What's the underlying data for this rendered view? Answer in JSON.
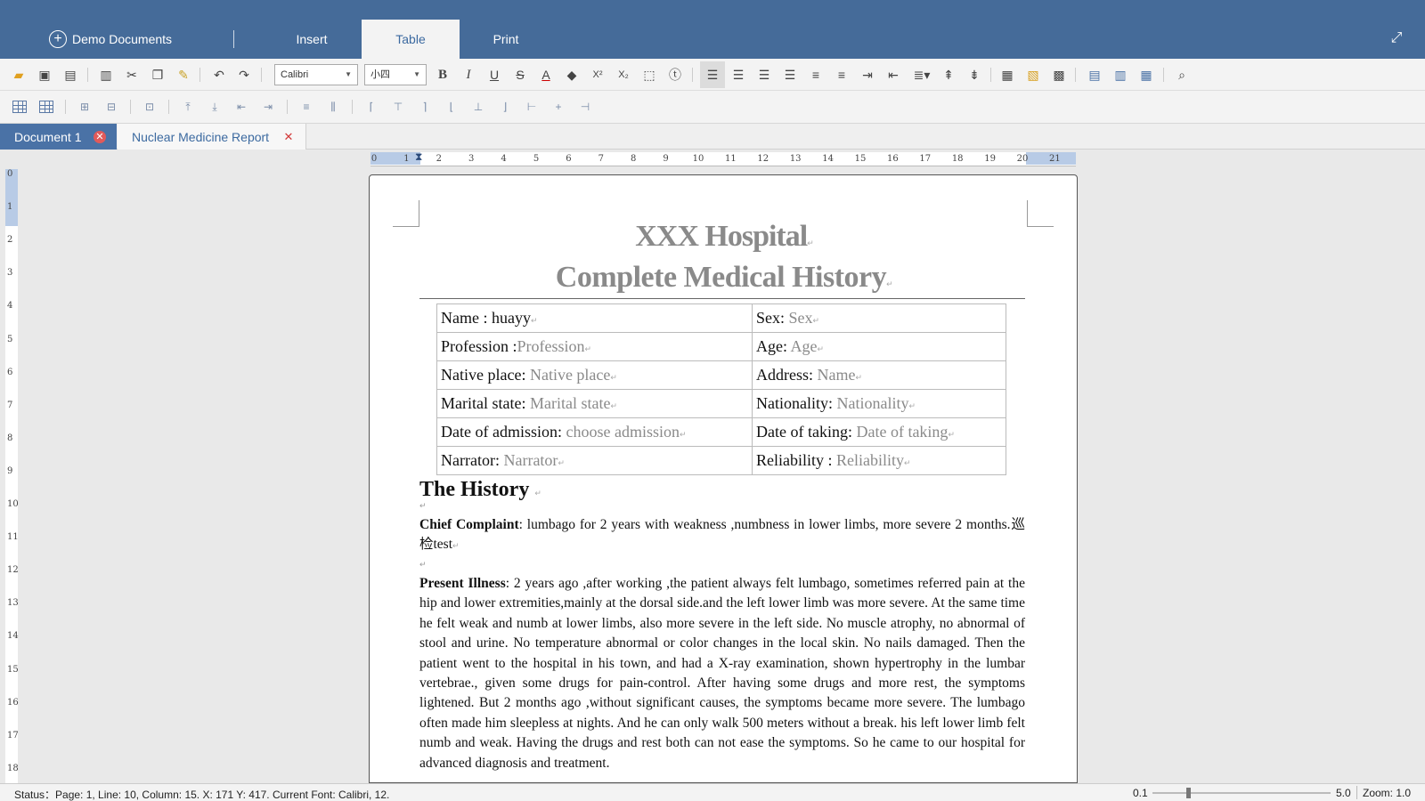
{
  "menu": {
    "demo_label": "Demo Documents",
    "plus_glyph": "+",
    "insert": "Insert",
    "table": "Table",
    "print": "Print",
    "fullscreen_glyph": "⤢"
  },
  "toolbar": {
    "font_name": "Calibri",
    "font_size": "小四",
    "bold": "B",
    "italic": "I",
    "underline": "U",
    "strike": "S",
    "font_color": "A",
    "superscript": "X²",
    "subscript": "X₂"
  },
  "doc_tabs": [
    {
      "label": "Document 1",
      "close": "✕"
    },
    {
      "label": "Nuclear Medicine Report",
      "close": "✕"
    }
  ],
  "ruler": {
    "h_ticks": [
      "0",
      "1",
      "2",
      "3",
      "4",
      "5",
      "6",
      "7",
      "8",
      "9",
      "10",
      "11",
      "12",
      "13",
      "14",
      "15",
      "16",
      "17",
      "18",
      "19",
      "20",
      "21"
    ],
    "v_ticks": [
      "0",
      "1",
      "2",
      "3",
      "4",
      "5",
      "6",
      "7",
      "8",
      "9",
      "10",
      "11",
      "12",
      "13",
      "14",
      "15",
      "16",
      "17",
      "18"
    ]
  },
  "doc": {
    "title1": "XXX Hospital",
    "title2": "Complete Medical History",
    "para_mark": "↵",
    "info_rows": [
      {
        "l_label": "Name : ",
        "l_value": "huayy",
        "l_ph": "",
        "r_label": "Sex: ",
        "r_ph": "Sex"
      },
      {
        "l_label": "Profession :",
        "l_value": "",
        "l_ph": "Profession",
        "r_label": "Age: ",
        "r_ph": "Age"
      },
      {
        "l_label": "Native place: ",
        "l_value": "",
        "l_ph": "Native place",
        "r_label": "Address: ",
        "r_ph": "Name"
      },
      {
        "l_label": "Marital state: ",
        "l_value": "",
        "l_ph": "Marital state",
        "r_label": "Nationality: ",
        "r_ph": "Nationality"
      },
      {
        "l_label": "Date of admission: ",
        "l_value": "",
        "l_ph": "choose admission",
        "r_label": "Date of taking: ",
        "r_ph": "Date of taking"
      },
      {
        "l_label": "Narrator: ",
        "l_value": "",
        "l_ph": "Narrator",
        "r_label": "Reliability : ",
        "r_ph": "Reliability"
      }
    ],
    "section_title": "The History",
    "chief_label": "Chief Complaint",
    "chief_text": ":  lumbago for 2 years with  weakness ,numbness  in lower limbs,  more severe 2 months.巡检test",
    "present_label": "Present Illness",
    "present_text": ": 2 years ago ,after working ,the patient always felt lumbago, sometimes referred pain at the hip and lower extremities,mainly at the dorsal side.and the left lower limb was more severe. At  the same time he felt weak and numb at lower limbs, also more severe in the left side. No muscle atrophy, no abnormal of stool and urine. No temperature abnormal or color changes in the local skin. No nails damaged. Then the patient went to the hospital in his town, and had a X-ray examination, shown hypertrophy in the lumbar vertebrae., given some drugs for pain-control. After having some drugs and more rest,  the symptoms lightened. But 2 months ago ,without significant causes, the symptoms became more severe. The lumbago often made him sleepless at nights. And he can only walk 500 meters without a break. his left lower limb felt numb and weak. Having the drugs and rest both can not ease the symptoms. So he came to our hospital for advanced diagnosis and treatment."
  },
  "status": {
    "text": "Status：Page: 1, Line: 10, Column: 15.  X: 171 Y: 417.  Current Font: Calibri, 12.",
    "zoom_min": "0.1",
    "zoom_max": "5.0",
    "zoom_label": "Zoom: 1.0",
    "zoom_fraction": 0.19
  }
}
